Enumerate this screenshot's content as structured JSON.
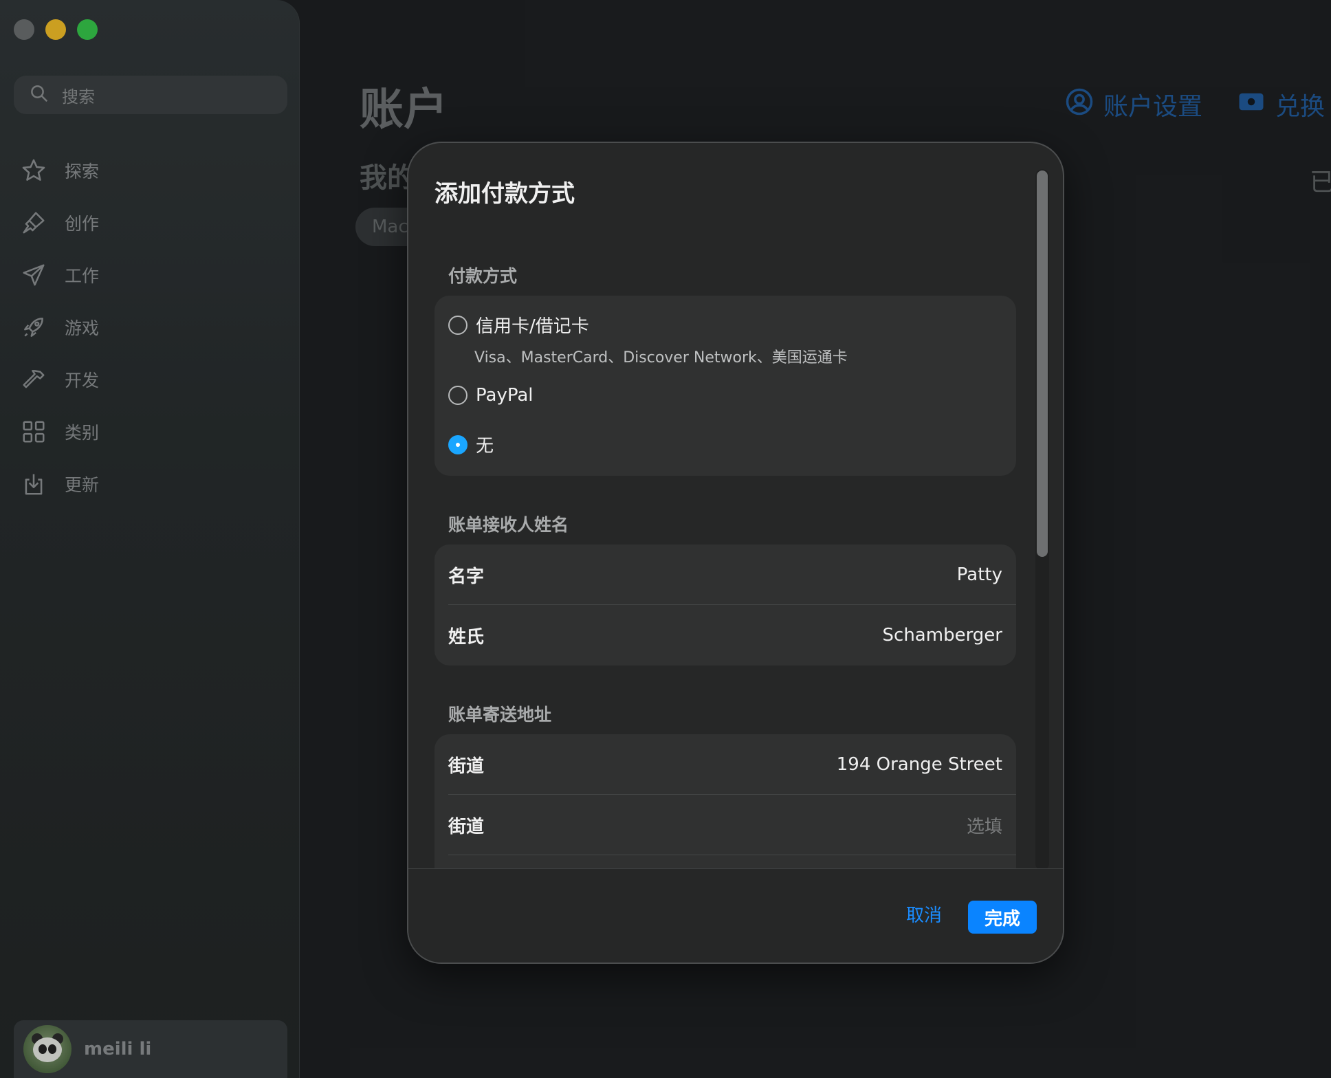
{
  "sidebar": {
    "search_placeholder": "搜索",
    "items": [
      {
        "label": "探索",
        "icon": "star-icon"
      },
      {
        "label": "创作",
        "icon": "brush-icon"
      },
      {
        "label": "工作",
        "icon": "paper-plane-icon"
      },
      {
        "label": "游戏",
        "icon": "rocket-icon"
      },
      {
        "label": "开发",
        "icon": "hammer-icon"
      },
      {
        "label": "类别",
        "icon": "grid-icon"
      },
      {
        "label": "更新",
        "icon": "download-icon"
      }
    ],
    "user_name": "meili li"
  },
  "main": {
    "title": "账户",
    "subheading": "我的",
    "chip": "Mac",
    "account_settings": "账户设置",
    "redeem": "兑换",
    "right_text": "已"
  },
  "sheet": {
    "title": "添加付款方式",
    "payment_section_label": "付款方式",
    "payment_options": [
      {
        "label": "信用卡/借记卡",
        "sub": "Visa、MasterCard、Discover Network、美国运通卡",
        "checked": false
      },
      {
        "label": "PayPal",
        "checked": false
      },
      {
        "label": "无",
        "checked": true
      }
    ],
    "name_section_label": "账单接收人姓名",
    "first_name_label": "名字",
    "first_name_value": "Patty",
    "last_name_label": "姓氏",
    "last_name_value": "Schamberger",
    "address_section_label": "账单寄送地址",
    "street1_label": "街道",
    "street1_value": "194 Orange Street",
    "street2_label": "街道",
    "street2_placeholder": "选填",
    "cancel_label": "取消",
    "done_label": "完成"
  },
  "colors": {
    "accent": "#0a84ff",
    "radio_checked": "#1aa6ff",
    "traffic_close": "#6b6e70",
    "traffic_min": "#f6c027",
    "traffic_max": "#35c84a"
  }
}
